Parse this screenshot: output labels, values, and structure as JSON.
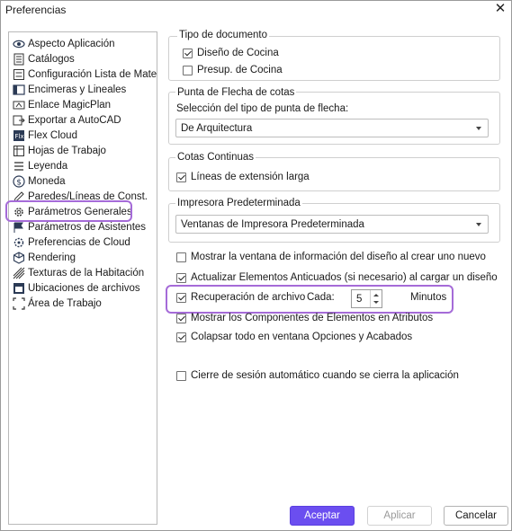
{
  "window": {
    "title": "Preferencias",
    "close_glyph": "✕"
  },
  "sidebar": {
    "items": [
      {
        "label": "Aspecto Aplicación",
        "icon": "eye-icon"
      },
      {
        "label": "Catálogos",
        "icon": "catalog-icon"
      },
      {
        "label": "Configuración Lista de Materia",
        "icon": "list-icon"
      },
      {
        "label": "Encimeras y Lineales",
        "icon": "countertop-icon"
      },
      {
        "label": "Enlace MagicPlan",
        "icon": "link-icon"
      },
      {
        "label": "Exportar a AutoCAD",
        "icon": "export-icon"
      },
      {
        "label": "Flex Cloud",
        "icon": "flex-icon"
      },
      {
        "label": "Hojas de Trabajo",
        "icon": "worksheet-icon"
      },
      {
        "label": "Leyenda",
        "icon": "legend-icon"
      },
      {
        "label": "Moneda",
        "icon": "currency-icon"
      },
      {
        "label": "Paredes/Líneas de Const.",
        "icon": "pencil-icon"
      },
      {
        "label": "Parámetros Generales",
        "icon": "gear-icon"
      },
      {
        "label": "Parámetros de Asistentes",
        "icon": "flag-icon"
      },
      {
        "label": "Preferencias de Cloud",
        "icon": "cloud-gear-icon"
      },
      {
        "label": "Rendering",
        "icon": "cube-icon"
      },
      {
        "label": "Texturas de la Habitación",
        "icon": "texture-icon"
      },
      {
        "label": "Ubicaciones de archivos",
        "icon": "folder-icon"
      },
      {
        "label": "Área de Trabajo",
        "icon": "workspace-icon"
      }
    ],
    "selected": "Parámetros Generales"
  },
  "tipo_documento": {
    "title": "Tipo de documento",
    "options": [
      {
        "label": "Diseño de Cocina",
        "checked": true
      },
      {
        "label": "Presup. de Cocina",
        "checked": false
      }
    ]
  },
  "punta_flecha": {
    "title": "Punta de Flecha de cotas",
    "prompt": "Selección del tipo de punta de flecha:",
    "selected": "De Arquitectura"
  },
  "cotas_continuas": {
    "title": "Cotas Continuas",
    "option": {
      "label": "Líneas de extensión larga",
      "checked": true
    }
  },
  "impresora": {
    "title": "Impresora Predeterminada",
    "selected": "Ventanas de Impresora Predeterminada"
  },
  "general_options": [
    {
      "label": "Mostrar la ventana de información del diseño al crear uno nuevo",
      "checked": false
    },
    {
      "label": "Actualizar Elementos Anticuados (si necesario) al cargar un diseño",
      "checked": true
    },
    {
      "label": "Recuperación de archivo",
      "checked": true
    },
    {
      "label": "Mostrar los Componentes de Elementos en Atributos",
      "checked": true
    },
    {
      "label": "Colapsar todo en ventana Opciones y Acabados",
      "checked": true
    },
    {
      "label": "Cierre de sesión automático cuando se cierra la aplicación",
      "checked": false
    }
  ],
  "recuperacion": {
    "cada_label": "Cada:",
    "value": "5",
    "unit": "Minutos"
  },
  "buttons": {
    "ok": "Aceptar",
    "apply": "Aplicar",
    "cancel": "Cancelar"
  },
  "colors": {
    "accent": "#6b4ef0",
    "highlight": "#a56bd8"
  }
}
